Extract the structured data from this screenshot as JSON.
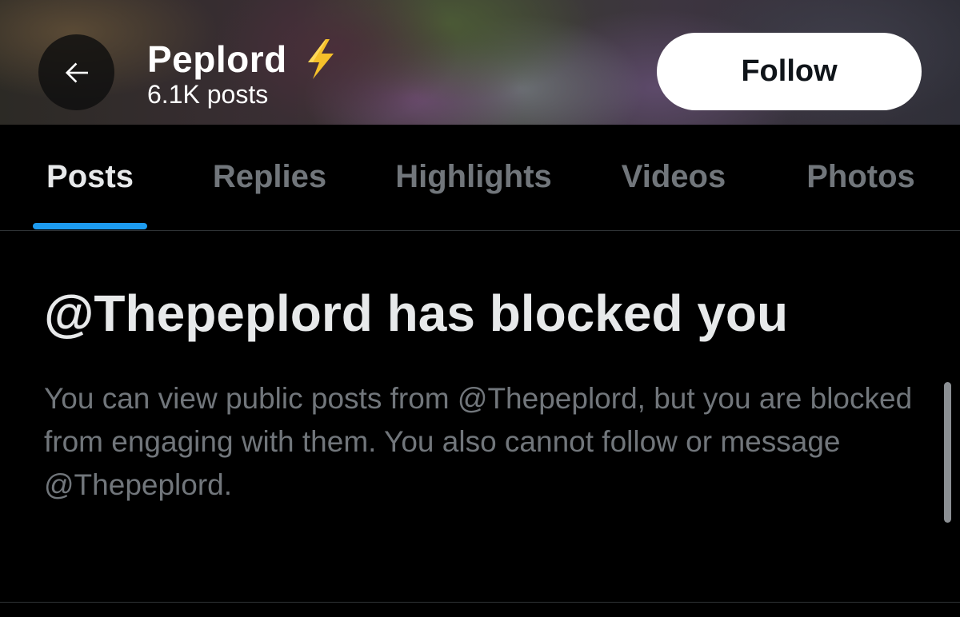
{
  "header": {
    "back_label": "Back",
    "profile_name": "Peplord",
    "name_emoji": "⚡",
    "posts_count": "6.1K posts",
    "follow_label": "Follow"
  },
  "tabs": [
    {
      "label": "Posts",
      "active": true
    },
    {
      "label": "Replies",
      "active": false
    },
    {
      "label": "Highlights",
      "active": false
    },
    {
      "label": "Videos",
      "active": false
    },
    {
      "label": "Photos",
      "active": false
    }
  ],
  "blocked": {
    "title": "@Thepeplord has blocked you",
    "description": "You can view public posts from @Thepeplord, but you are blocked from engaging with them. You also cannot follow or message @Thepeplord."
  },
  "colors": {
    "background": "#000000",
    "accent": "#1d9bf0",
    "text_primary": "#e7e9ea",
    "text_secondary": "#71767b",
    "bolt": "#f5c02a"
  },
  "icons": {
    "back": "arrow-left-icon",
    "emoji": "lightning-bolt-icon"
  }
}
